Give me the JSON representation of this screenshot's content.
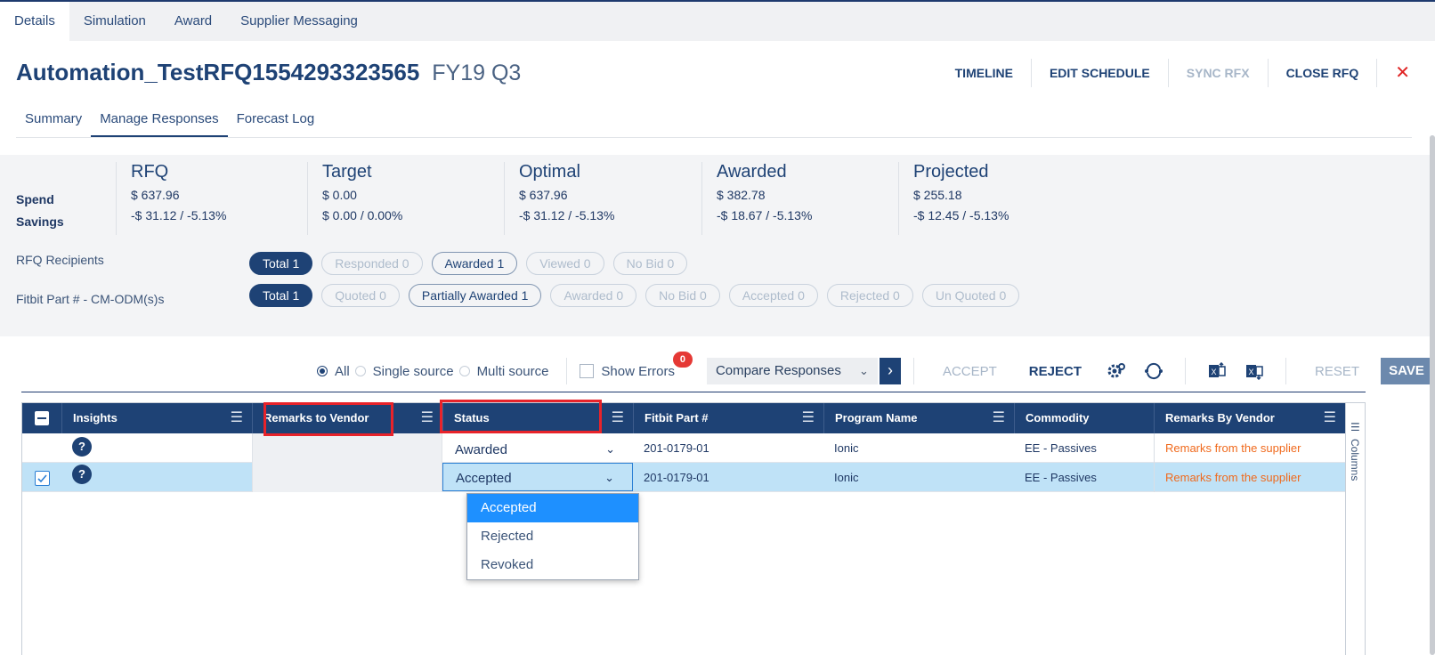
{
  "top_tabs": [
    "Details",
    "Simulation",
    "Award",
    "Supplier Messaging"
  ],
  "header": {
    "title": "Automation_TestRFQ1554293323565",
    "subtitle": "FY19 Q3",
    "actions": {
      "timeline": "TIMELINE",
      "edit_schedule": "EDIT SCHEDULE",
      "sync_rfx": "SYNC RFX",
      "close_rfq": "CLOSE RFQ",
      "close_icon": "✕"
    }
  },
  "sub_tabs": [
    "Summary",
    "Manage Responses",
    "Forecast Log"
  ],
  "summary": {
    "row_labels": {
      "spend": "Spend",
      "savings": "Savings"
    },
    "metrics": [
      {
        "title": "RFQ",
        "spend": "$ 637.96",
        "savings": "-$ 31.12 / -5.13%"
      },
      {
        "title": "Target",
        "spend": "$ 0.00",
        "savings": "$ 0.00 / 0.00%"
      },
      {
        "title": "Optimal",
        "spend": "$ 637.96",
        "savings": "-$ 31.12 / -5.13%"
      },
      {
        "title": "Awarded",
        "spend": "$ 382.78",
        "savings": "-$ 18.67 / -5.13%"
      },
      {
        "title": "Projected",
        "spend": "$ 255.18",
        "savings": "-$ 12.45 / -5.13%"
      }
    ],
    "recipients_label": "RFQ Recipients",
    "recipients": [
      "Total 1",
      "Responded 0",
      "Awarded 1",
      "Viewed 0",
      "No Bid 0"
    ],
    "parts_label": "Fitbit Part # - CM-ODM(s)s",
    "parts": [
      "Total 1",
      "Quoted 0",
      "Partially Awarded 1",
      "Awarded 0",
      "No Bid 0",
      "Accepted 0",
      "Rejected 0",
      "Un Quoted 0"
    ]
  },
  "toolbar": {
    "radios": [
      "All",
      "Single source",
      "Multi source"
    ],
    "selected_radio": "All",
    "show_errors": "Show Errors",
    "error_count": "0",
    "compare": "Compare Responses",
    "accept": "ACCEPT",
    "reject": "REJECT",
    "reset": "RESET",
    "save": "SAVE"
  },
  "grid": {
    "columns": [
      "Insights",
      "Remarks to Vendor",
      "Status",
      "Fitbit Part #",
      "Program Name",
      "Commodity",
      "Remarks By Vendor"
    ],
    "rows": [
      {
        "help": "?",
        "remarks": "",
        "status": "Awarded",
        "part": "201-0179-01",
        "program": "Ionic",
        "commodity": "EE - Passives",
        "vendor_remarks": "Remarks from the supplier"
      },
      {
        "help": "?",
        "remarks": "",
        "status": "Accepted",
        "part": "201-0179-01",
        "program": "Ionic",
        "commodity": "EE - Passives",
        "vendor_remarks": "Remarks from the supplier"
      }
    ],
    "side_label": "Columns"
  },
  "status_dropdown": {
    "options": [
      "Accepted",
      "Rejected",
      "Revoked"
    ],
    "selected": "Accepted"
  },
  "colors": {
    "primary": "#1e4275",
    "vendor_text": "#f06a1d",
    "error_badge": "#e53935",
    "highlight": "#e8232a",
    "selected_row": "#bfe2f7"
  }
}
